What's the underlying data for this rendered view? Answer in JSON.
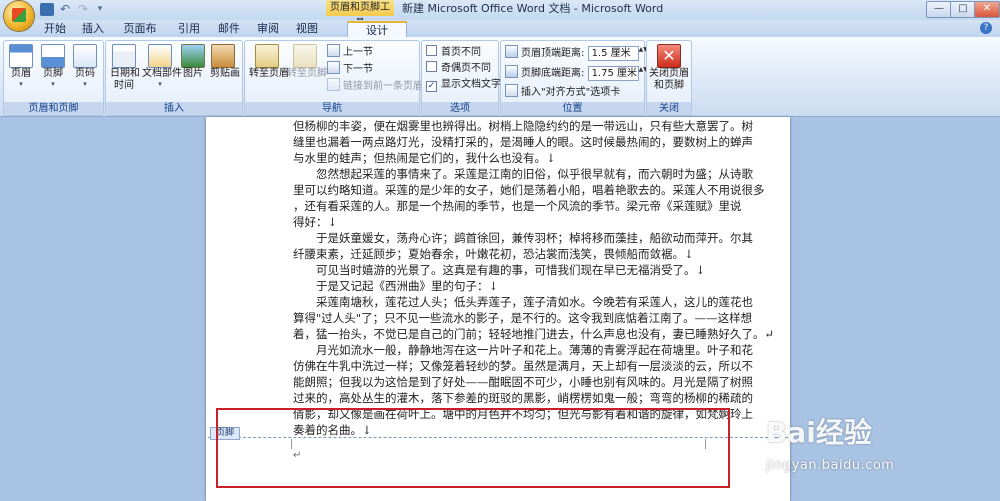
{
  "titlebar": {
    "contextual_tab_title": "页眉和页脚工具",
    "window_title": "新建 Microsoft Office Word 文档 - Microsoft Word",
    "undo": "↶",
    "redo": "↷",
    "more": "▾",
    "min": "—",
    "max": "□",
    "close": "✕"
  },
  "tabs": [
    "开始",
    "插入",
    "页面布局",
    "引用",
    "邮件",
    "审阅",
    "视图",
    "设计"
  ],
  "help": "?",
  "ribbon": {
    "groups": {
      "header_footer": {
        "label": "页眉和页脚",
        "buttons": [
          "页眉",
          "页脚",
          "页码"
        ],
        "dropdown_arrow": "▾"
      },
      "insert": {
        "label": "插入",
        "datetime_line1": "日期和",
        "datetime_line2": "时间",
        "docparts": "文档部件",
        "picture": "图片",
        "clipart": "剪贴画"
      },
      "navigation": {
        "label": "导航",
        "goto_header": "转至页眉",
        "goto_footer": "转至页脚",
        "prev": "上一节",
        "next": "下一节",
        "link_prev": "链接到前一条页眉"
      },
      "options": {
        "label": "选项",
        "first_page_diff": "首页不同",
        "odd_even_diff": "奇偶页不同",
        "show_doc_text": "显示文档文字",
        "first_page_checked": false,
        "odd_even_checked": false,
        "show_doc_text_checked": true,
        "check_mark": "✓"
      },
      "position": {
        "label": "位置",
        "header_top_label": "页眉顶端距离:",
        "header_top_value": "1.5 厘米",
        "footer_bottom_label": "页脚底端距离:",
        "footer_bottom_value": "1.75 厘米",
        "insert_align_tab": "插入\"对齐方式\"选项卡",
        "spin_arrows": "▲▼"
      },
      "close": {
        "label": "关闭",
        "close_line1": "关闭页眉",
        "close_line2": "和页脚",
        "close_glyph": "✕"
      }
    }
  },
  "document": {
    "lines": [
      "但杨柳的丰姿，便在烟雾里也辨得出。树梢上隐隐约约的是一带远山，只有些大意罢了。树",
      "缝里也漏着一两点路灯光，没精打采的，是渴睡人的眼。这时候最热闹的，要数树上的蝉声",
      "与水里的蛙声；但热闹是它们的，我什么也没有。↓",
      "　　忽然想起采莲的事情来了。采莲是江南的旧俗，似乎很早就有，而六朝时为盛；从诗歌",
      "里可以约略知道。采莲的是少年的女子，她们是荡着小船，唱着艳歌去的。采莲人不用说很多",
      "，还有看采莲的人。那是一个热闹的季节，也是一个风流的季节。梁元帝《采莲赋》里说",
      "得好：↓",
      "　　于是妖童媛女，荡舟心许；鹢首徐回，兼传羽杯；棹将移而藻挂，船欲动而萍开。尔其",
      "纤腰束素，迁延顾步；夏始春余，叶嫩花初，恐沾裳而浅笑，畏倾船而敛裾。↓",
      "　　可见当时嬉游的光景了。这真是有趣的事，可惜我们现在早已无福消受了。↓",
      "　　于是又记起《西洲曲》里的句子：↓",
      "　　采莲南塘秋，莲花过人头；低头弄莲子，莲子清如水。今晚若有采莲人，这儿的莲花也",
      "算得\"过人头\"了；只不见一些流水的影子，是不行的。这令我到底惦着江南了。——这样想",
      "着，猛一抬头，不觉已是自己的门前；轻轻地推门进去，什么声息也没有，妻已睡熟好久了。↵",
      "　　月光如流水一般，静静地泻在这一片叶子和花上。薄薄的青雾浮起在荷塘里。叶子和花",
      "仿佛在牛乳中洗过一样；又像笼着轻纱的梦。虽然是满月，天上却有一层淡淡的云，所以不",
      "能朗照；但我以为这恰是到了好处——酣眠固不可少，小睡也别有风味的。月光是隔了树照",
      "过来的，高处丛生的灌木，落下参差的斑驳的黑影，峭楞楞如鬼一般；弯弯的杨柳的稀疏的",
      "倩影，却又像是画在荷叶上。塘中的月色并不均匀；但光与影有着和谐的旋律，如梵婀玲上",
      "奏着的名曲。↓"
    ],
    "footer_tag": "页脚",
    "footer_cursor": "↵"
  },
  "watermark": {
    "logo": "Bai经验",
    "url": "jingyan.baidu.com"
  },
  "colors": {
    "highlight": "#c8202a",
    "contextual_tab": "#f3c94b",
    "ribbon_label": "#15428b"
  }
}
